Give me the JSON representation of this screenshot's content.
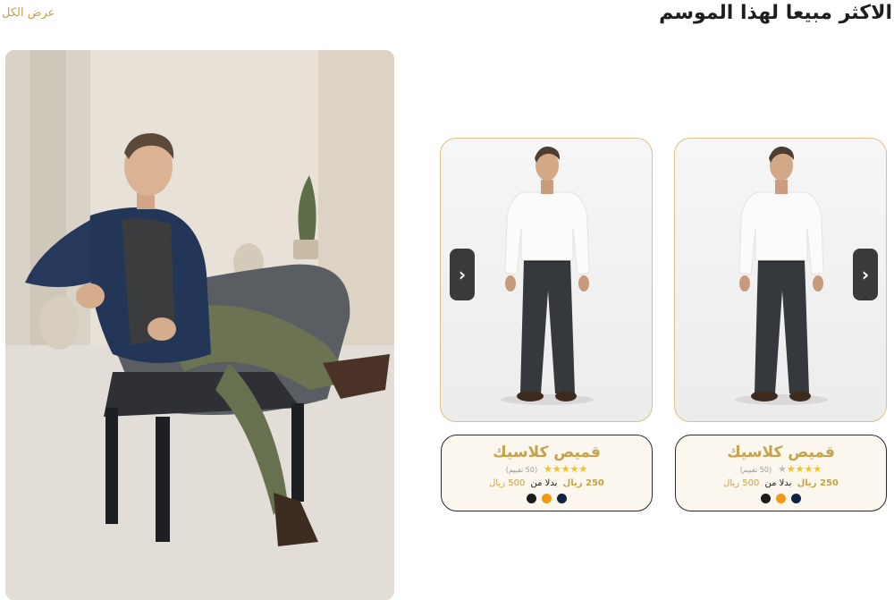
{
  "section": {
    "title": "الاكثر مبيعا لهذا الموسم",
    "view_all": "عرض الكل"
  },
  "hero": {
    "image": "man-seated-in-chair-lifestyle-photo"
  },
  "products": [
    {
      "name": "قميص كلاسيك",
      "stars_filled": "★★★★",
      "stars_empty": "★",
      "reviews": "(50 تقييم)",
      "price_now": "250 ريال",
      "price_sep": "بدلا من",
      "price_old": "500 ريال",
      "arrow": "›",
      "colors": [
        "#1b1b1b",
        "#f29a13",
        "#0f2242"
      ]
    },
    {
      "name": "قميص كلاسيك",
      "stars_filled": "★★★★★",
      "stars_empty": "",
      "reviews": "(50 تقييم)",
      "price_now": "250 ريال",
      "price_sep": "بدلا من",
      "price_old": "500 ريال",
      "arrow": "›",
      "colors": [
        "#1b1b1b",
        "#f29a13",
        "#0f2242"
      ]
    }
  ]
}
